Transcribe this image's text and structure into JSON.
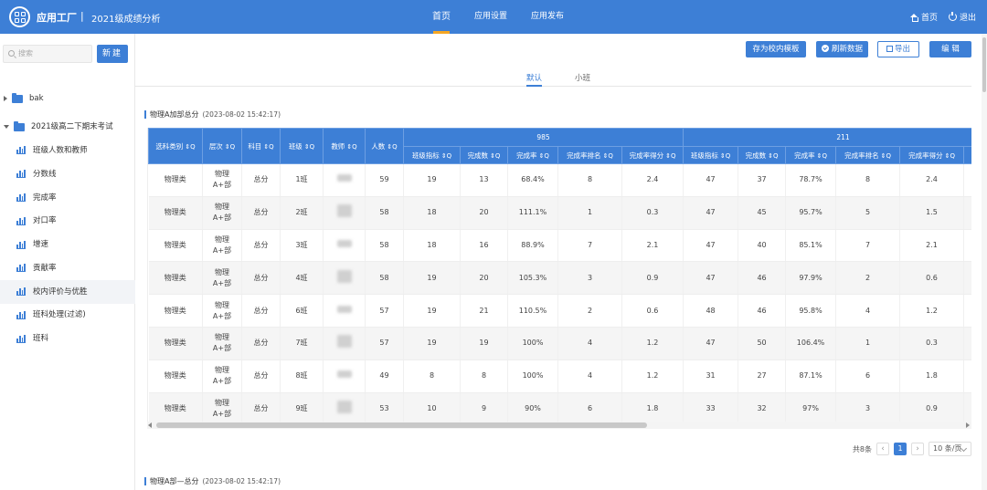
{
  "header": {
    "app_name": "应用工厂",
    "separator": "|",
    "page_name": "2021级成绩分析",
    "nav": [
      "首页",
      "应用设置",
      "应用发布"
    ],
    "home_label": "首页",
    "logout_label": "退出"
  },
  "sidebar": {
    "search_placeholder": "搜索",
    "new_button": "新建",
    "folders": [
      {
        "label": "bak",
        "expanded": false
      },
      {
        "label": "2021级高二下期末考试",
        "expanded": true
      }
    ],
    "items": [
      "班级人数和教师",
      "分数线",
      "完成率",
      "对口率",
      "增速",
      "贡献率",
      "校内评价与优胜",
      "班科处理(过滤)",
      "班科"
    ],
    "selected_index": 6
  },
  "toolbar": {
    "save_template": "存为校内模板",
    "refresh": "刷新数据",
    "export": "导出",
    "edit": "编 辑"
  },
  "subtabs": [
    "默认",
    "小班"
  ],
  "section1": {
    "title": "物理A加部总分",
    "timestamp": "(2023-08-02 15:42:17)"
  },
  "section2": {
    "title": "物理A部—总分",
    "timestamp": "(2023-08-02 15:42:17)"
  },
  "table": {
    "fixed_headers": [
      "选科类别",
      "层次",
      "科目",
      "班级",
      "教师",
      "人数"
    ],
    "groups": [
      "985",
      "211"
    ],
    "sub_headers": [
      "班级指标",
      "完成数",
      "完成率",
      "完成率排名",
      "完成率得分"
    ],
    "sort_glyph": "⇕Q",
    "rows": [
      {
        "cat": "物理类",
        "level": "物理\nA+部",
        "subject": "总分",
        "cls": "1班",
        "n": "59",
        "g985": [
          "19",
          "13",
          "68.4%",
          "8",
          "2.4"
        ],
        "g211": [
          "47",
          "37",
          "78.7%",
          "8",
          "2.4"
        ]
      },
      {
        "cat": "物理类",
        "level": "物理\nA+部",
        "subject": "总分",
        "cls": "2班",
        "n": "58",
        "g985": [
          "18",
          "20",
          "111.1%",
          "1",
          "0.3"
        ],
        "g211": [
          "47",
          "45",
          "95.7%",
          "5",
          "1.5"
        ]
      },
      {
        "cat": "物理类",
        "level": "物理\nA+部",
        "subject": "总分",
        "cls": "3班",
        "n": "58",
        "g985": [
          "18",
          "16",
          "88.9%",
          "7",
          "2.1"
        ],
        "g211": [
          "47",
          "40",
          "85.1%",
          "7",
          "2.1"
        ]
      },
      {
        "cat": "物理类",
        "level": "物理\nA+部",
        "subject": "总分",
        "cls": "4班",
        "n": "58",
        "g985": [
          "19",
          "20",
          "105.3%",
          "3",
          "0.9"
        ],
        "g211": [
          "47",
          "46",
          "97.9%",
          "2",
          "0.6"
        ]
      },
      {
        "cat": "物理类",
        "level": "物理\nA+部",
        "subject": "总分",
        "cls": "6班",
        "n": "57",
        "g985": [
          "19",
          "21",
          "110.5%",
          "2",
          "0.6"
        ],
        "g211": [
          "48",
          "46",
          "95.8%",
          "4",
          "1.2"
        ]
      },
      {
        "cat": "物理类",
        "level": "物理\nA+部",
        "subject": "总分",
        "cls": "7班",
        "n": "57",
        "g985": [
          "19",
          "19",
          "100%",
          "4",
          "1.2"
        ],
        "g211": [
          "47",
          "50",
          "106.4%",
          "1",
          "0.3"
        ]
      },
      {
        "cat": "物理类",
        "level": "物理\nA+部",
        "subject": "总分",
        "cls": "8班",
        "n": "49",
        "g985": [
          "8",
          "8",
          "100%",
          "4",
          "1.2"
        ],
        "g211": [
          "31",
          "27",
          "87.1%",
          "6",
          "1.8"
        ]
      },
      {
        "cat": "物理类",
        "level": "物理\nA+部",
        "subject": "总分",
        "cls": "9班",
        "n": "53",
        "g985": [
          "10",
          "9",
          "90%",
          "6",
          "1.8"
        ],
        "g211": [
          "33",
          "32",
          "97%",
          "3",
          "0.9"
        ]
      }
    ]
  },
  "pagination": {
    "total": "共8条",
    "current": "1",
    "page_size": "10 条/页"
  },
  "colors": {
    "primary": "#3d7fd6",
    "accent": "#f5a623"
  }
}
